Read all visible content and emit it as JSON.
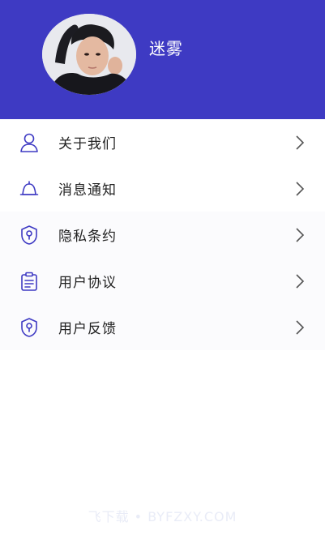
{
  "header": {
    "username": "迷雾",
    "background_color": "#3e3ac3",
    "avatar_alt": "user-avatar"
  },
  "menu": {
    "items": [
      {
        "label": "关于我们",
        "icon": "user-outline-icon"
      },
      {
        "label": "消息通知",
        "icon": "bell-icon"
      },
      {
        "label": "隐私条约",
        "icon": "shield-lock-icon"
      },
      {
        "label": "用户协议",
        "icon": "clipboard-icon"
      },
      {
        "label": "用户反馈",
        "icon": "shield-lock-icon"
      }
    ],
    "icon_color": "#3e3ac3",
    "chevron_icon": "chevron-right-icon"
  },
  "watermark": {
    "text": "飞下载 • BYFZXY.COM"
  }
}
